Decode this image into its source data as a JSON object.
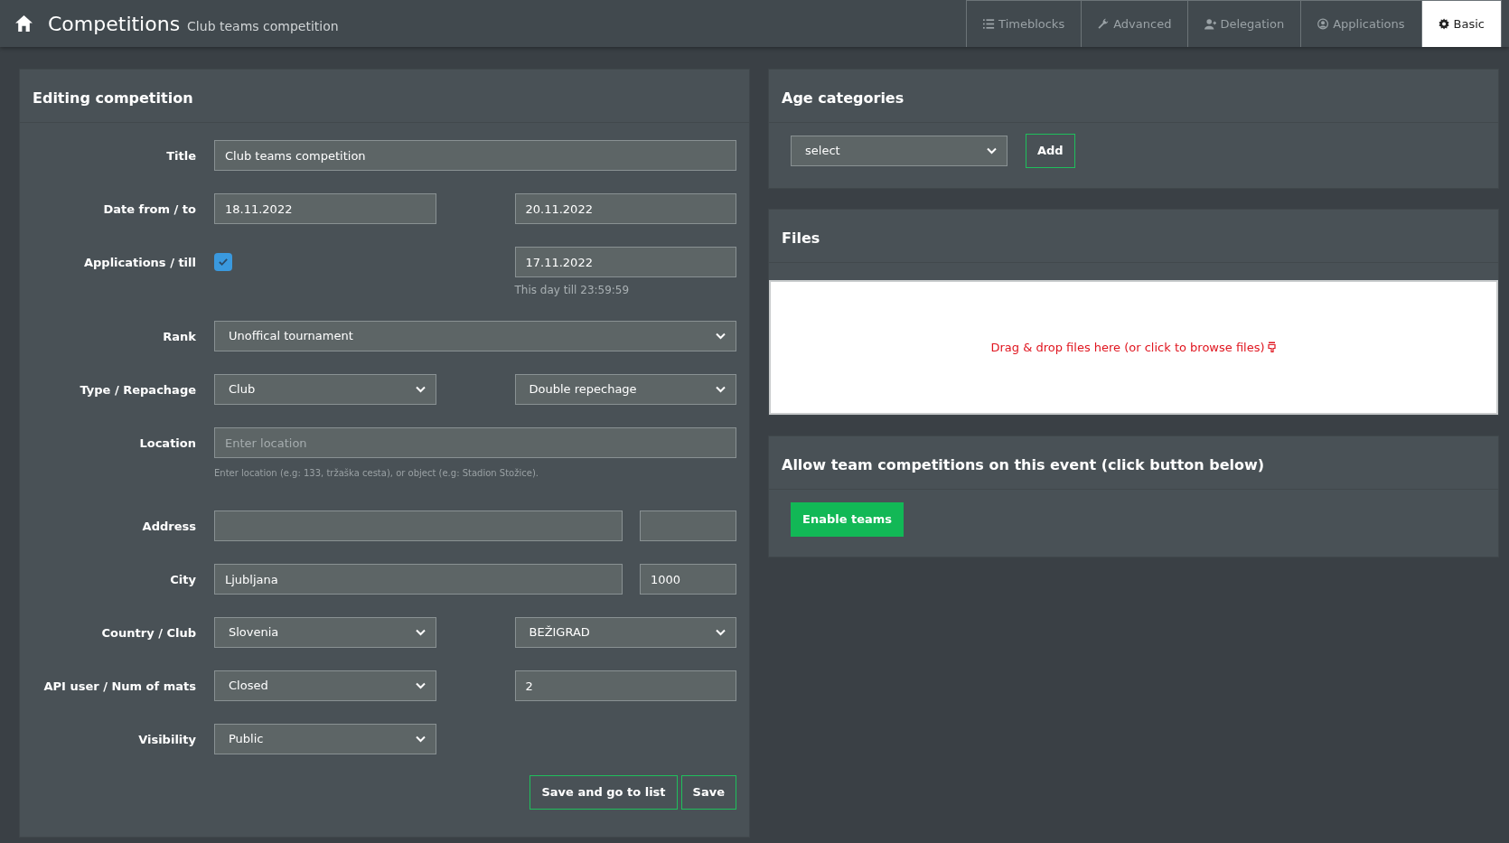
{
  "header": {
    "title": "Competitions",
    "subtitle": "Club teams competition"
  },
  "tabs": [
    {
      "label": "Timeblocks",
      "selected": false
    },
    {
      "label": "Advanced",
      "selected": false
    },
    {
      "label": "Delegation",
      "selected": false
    },
    {
      "label": "Applications",
      "selected": false
    },
    {
      "label": "Basic",
      "selected": true
    }
  ],
  "editing": {
    "title": "Editing competition",
    "rows": [
      {
        "label": "Title",
        "kind": "wide",
        "fields": [
          {
            "kind": "text",
            "value": "Club teams competition"
          }
        ]
      },
      {
        "label": "Date from / to",
        "kind": "pair",
        "fields": [
          {
            "kind": "text",
            "value": "18.11.2022"
          },
          {
            "kind": "text",
            "value": "20.11.2022"
          }
        ]
      },
      {
        "label": "Applications / till",
        "kind": "pair",
        "fields": [
          {
            "kind": "checkbox",
            "checked": true
          },
          {
            "kind": "text",
            "value": "17.11.2022",
            "help": "This day till 23:59:59"
          }
        ]
      },
      {
        "label": "Rank",
        "kind": "wide",
        "fields": [
          {
            "kind": "select",
            "value": "Unoffical tournament"
          }
        ]
      },
      {
        "label": "Type / Repachage",
        "kind": "pair",
        "fields": [
          {
            "kind": "select",
            "value": "Club"
          },
          {
            "kind": "select",
            "value": "Double repechage"
          }
        ]
      },
      {
        "label": "Location",
        "kind": "wide",
        "fields": [
          {
            "kind": "text",
            "placeholder": "Enter location",
            "help": "Enter location (e.g: 133, tržaška cesta), or object (e.g: Stadion Stožice)."
          }
        ]
      },
      {
        "label": "Address",
        "kind": "split",
        "fields": [
          {
            "kind": "text"
          },
          {
            "kind": "text"
          }
        ]
      },
      {
        "label": "City",
        "kind": "split",
        "fields": [
          {
            "kind": "text",
            "value": "Ljubljana"
          },
          {
            "kind": "text",
            "value": "1000"
          }
        ]
      },
      {
        "label": "Country / Club",
        "kind": "pair",
        "fields": [
          {
            "kind": "select",
            "value": "Slovenia"
          },
          {
            "kind": "select",
            "value": "BEŽIGRAD"
          }
        ]
      },
      {
        "label": "API user / Num of mats",
        "kind": "pair",
        "fields": [
          {
            "kind": "select",
            "value": "Closed"
          },
          {
            "kind": "text",
            "value": "2"
          }
        ]
      },
      {
        "label": "Visibility",
        "kind": "single",
        "fields": [
          {
            "kind": "select",
            "value": "Public"
          }
        ]
      }
    ],
    "buttons": [
      "Save and go to list",
      "Save"
    ]
  },
  "age_categories": {
    "title": "Age categories",
    "select": "select",
    "button": "Add"
  },
  "files": {
    "title": "Files",
    "dropzone": "Drag & drop files here (or click to browse files)"
  },
  "teams": {
    "title": "Allow team competitions on this event (click button below)",
    "button": "Enable teams"
  }
}
